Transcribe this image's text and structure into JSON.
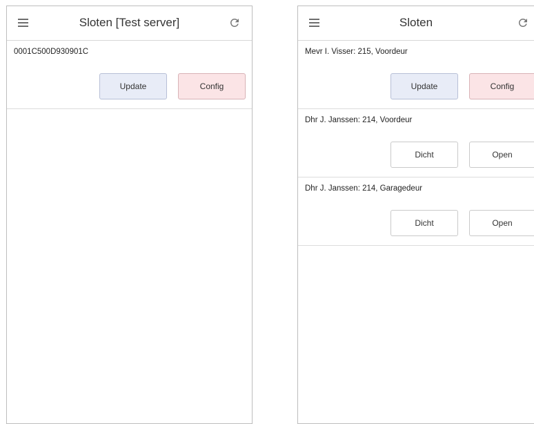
{
  "left_screen": {
    "title": "Sloten [Test server]",
    "items": [
      {
        "label": "0001C500D930901C",
        "buttons": [
          "Update",
          "Config"
        ]
      }
    ]
  },
  "right_screen": {
    "title": "Sloten",
    "items": [
      {
        "label": "Mevr I. Visser: 215, Voordeur",
        "buttons": [
          "Update",
          "Config"
        ]
      },
      {
        "label": "Dhr J. Janssen: 214, Voordeur",
        "buttons": [
          "Dicht",
          "Open"
        ]
      },
      {
        "label": "Dhr J. Janssen: 214, Garagedeur",
        "buttons": [
          "Dicht",
          "Open"
        ]
      }
    ]
  },
  "icons": {
    "menu": "hamburger-menu-icon",
    "refresh": "refresh-icon"
  },
  "colors": {
    "update_button": "#e8ecf7",
    "config_button": "#fbe4e6",
    "plain_button": "#ffffff"
  }
}
